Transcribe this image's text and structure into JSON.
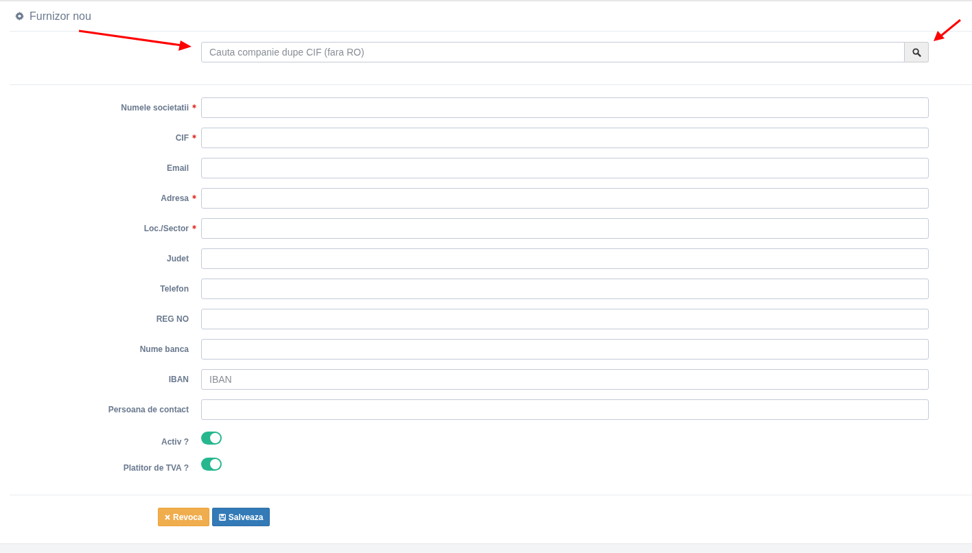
{
  "panel": {
    "title": "Furnizor nou"
  },
  "search": {
    "placeholder": "Cauta companie dupe CIF (fara RO)"
  },
  "fields": [
    {
      "kind": "text",
      "label": "Numele societatii",
      "required": true
    },
    {
      "kind": "text",
      "label": "CIF",
      "required": true
    },
    {
      "kind": "text",
      "label": "Email",
      "required": false
    },
    {
      "kind": "text",
      "label": "Adresa",
      "required": true
    },
    {
      "kind": "text",
      "label": "Loc./Sector",
      "required": true
    },
    {
      "kind": "text",
      "label": "Judet",
      "required": false
    },
    {
      "kind": "text",
      "label": "Telefon",
      "required": false
    },
    {
      "kind": "text",
      "label": "REG NO",
      "required": false
    },
    {
      "kind": "text",
      "label": "Nume banca",
      "required": false
    },
    {
      "kind": "text",
      "label": "IBAN",
      "required": false,
      "placeholder": "IBAN"
    },
    {
      "kind": "text",
      "label": "Persoana de contact",
      "required": false
    },
    {
      "kind": "toggle",
      "label": "Activ ?",
      "on": true
    },
    {
      "kind": "toggle",
      "label": "Platitor de TVA ?",
      "on": true
    }
  ],
  "buttons": [
    {
      "kind": "cancel",
      "label": "Revoca"
    },
    {
      "kind": "save",
      "label": "Salveaza"
    }
  ]
}
